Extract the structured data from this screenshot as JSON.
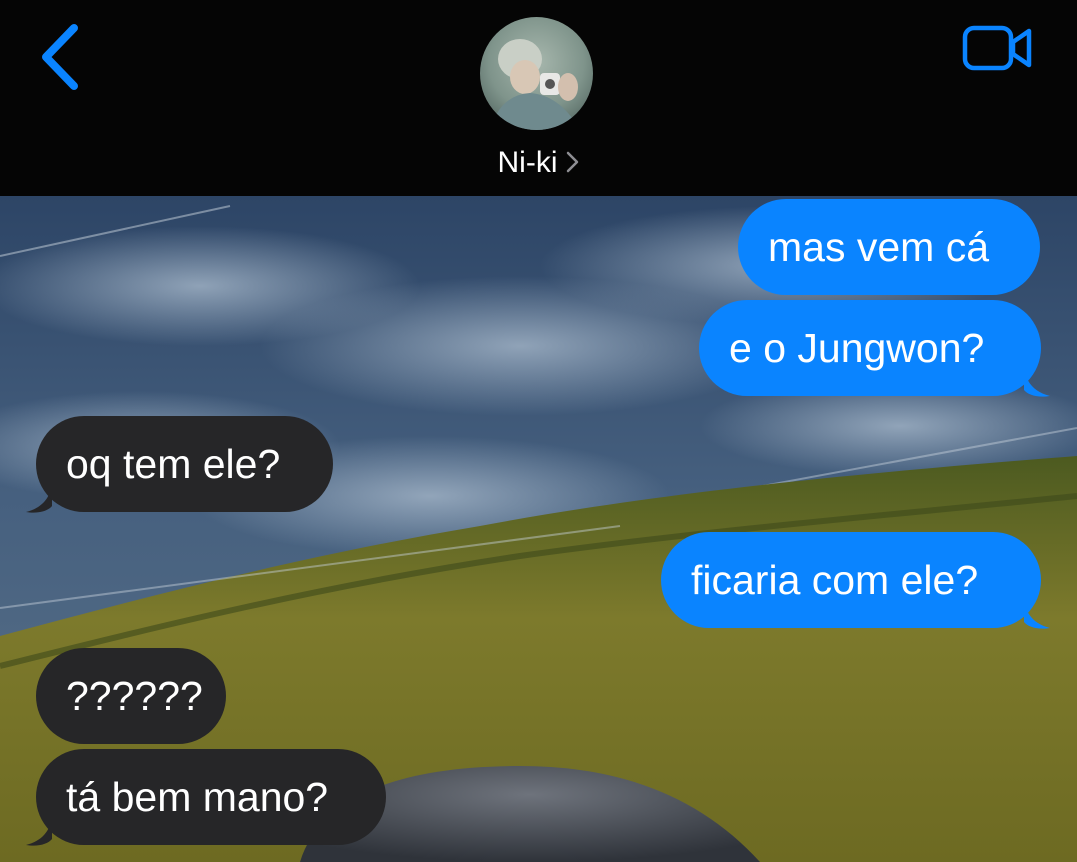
{
  "header": {
    "contact_name": "Ni-ki",
    "back_icon": "chevron-left-icon",
    "video_icon": "video-camera-icon",
    "avatar_icon": "contact-avatar",
    "accent_color": "#0A84FF"
  },
  "messages": [
    {
      "direction": "outgoing",
      "text": "mas vem cá"
    },
    {
      "direction": "outgoing",
      "text": "e o Jungwon?"
    },
    {
      "direction": "incoming",
      "text": "oq tem ele?"
    },
    {
      "direction": "outgoing",
      "text": "ficaria com ele?"
    },
    {
      "direction": "incoming",
      "text": "??????"
    },
    {
      "direction": "incoming",
      "text": "tá bem mano?"
    }
  ],
  "colors": {
    "outgoing_bubble": "#0A84FF",
    "incoming_bubble": "#262628",
    "header_background": "#050505"
  }
}
